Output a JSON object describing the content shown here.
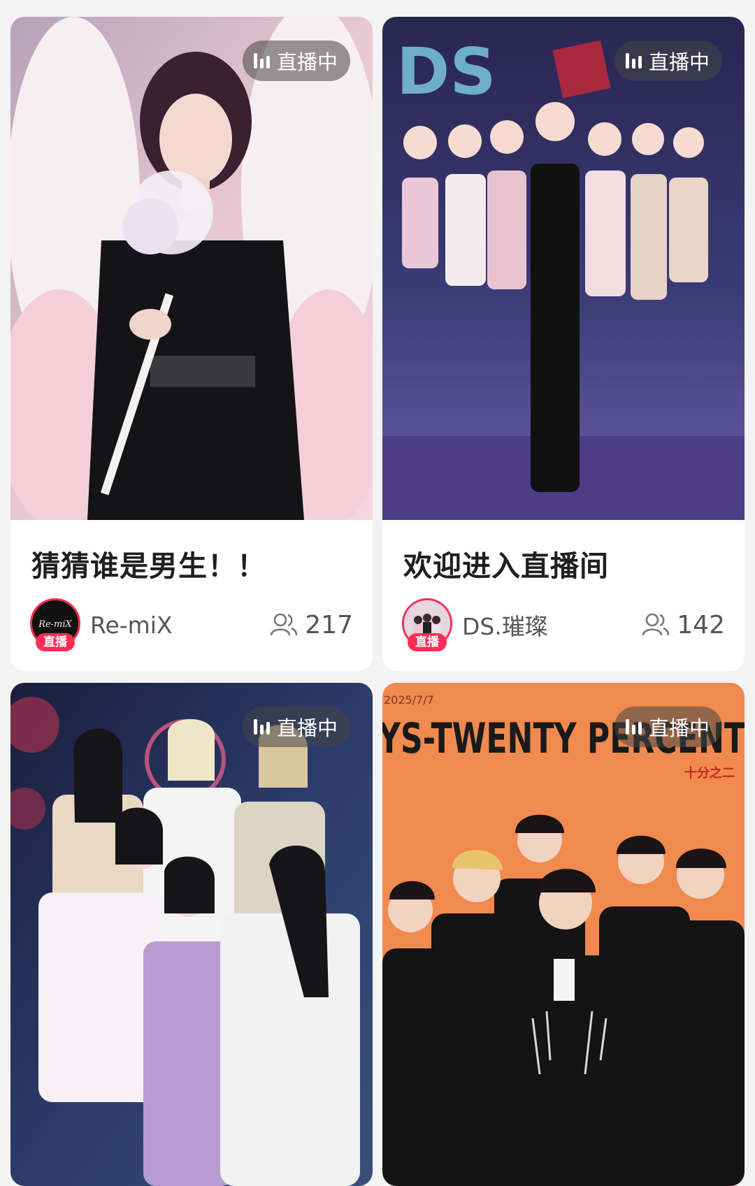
{
  "cards": [
    {
      "title": "猜猜谁是男生！！",
      "live_label": "直播中",
      "username": "Re-miX",
      "viewers": "217",
      "avatar_badge": "直播",
      "avatar_text": "Re-miX"
    },
    {
      "title": "欢迎进入直播间",
      "live_label": "直播中",
      "username": "DS.璀璨",
      "viewers": "142",
      "avatar_badge": "直播"
    },
    {
      "live_label": "直播中"
    },
    {
      "live_label": "直播中",
      "cover_text": "YS-TWENTY PERCENT",
      "cover_date": "2025/7/7",
      "cover_subtext": "十分之二"
    }
  ]
}
